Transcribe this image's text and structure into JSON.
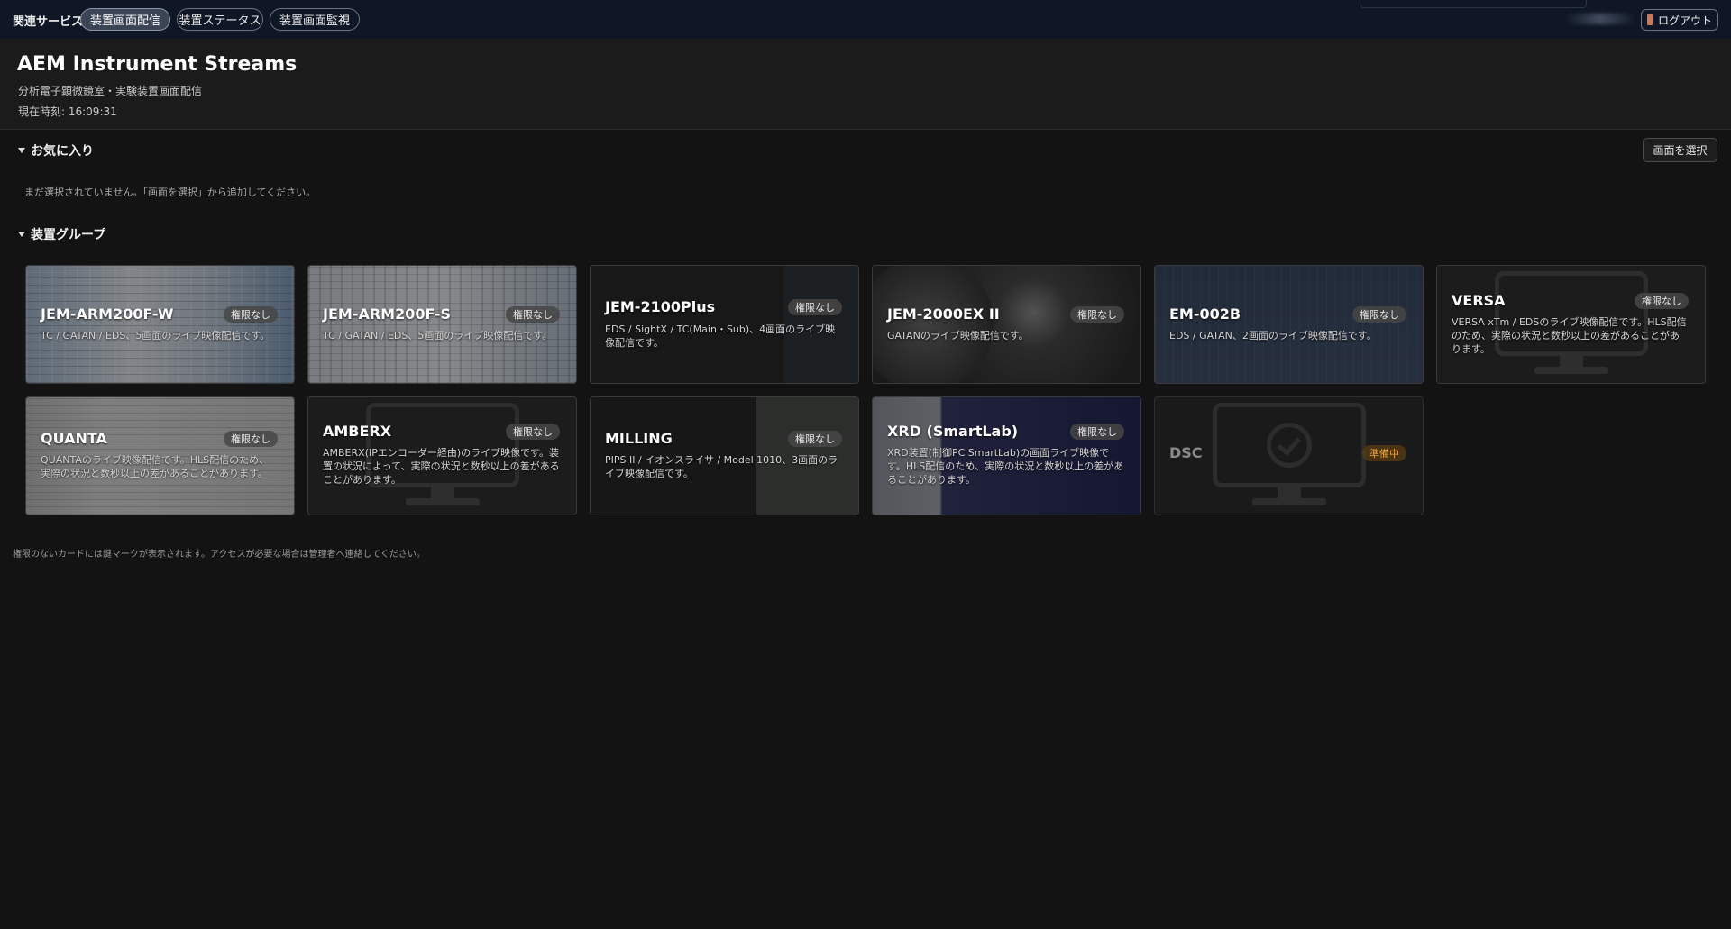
{
  "topbar": {
    "related_label": "関連サービス",
    "tabs": [
      {
        "label": "装置画面配信",
        "active": true
      },
      {
        "label": "装置ステータス",
        "active": false
      },
      {
        "label": "装置画面監視",
        "active": false
      }
    ],
    "logout_label": "ログアウト"
  },
  "header": {
    "title": "AEM Instrument Streams",
    "subtitle": "分析電子顕微鏡室・実験装置画面配信",
    "time": "現在時刻: 16:09:31"
  },
  "favorites": {
    "heading": "お気に入り",
    "select_button": "画面を選択",
    "empty_message": "まだ選択されていません。「画面を選択」から追加してください。"
  },
  "groups": {
    "heading": "装置グループ",
    "cards": [
      {
        "name": "JEM-ARM200F-W",
        "badge": "権限なし",
        "desc": "TC / GATAN / EDS、5画面のライブ映像配信です。"
      },
      {
        "name": "JEM-ARM200F-S",
        "badge": "権限なし",
        "desc": "TC / GATAN / EDS、5画面のライブ映像配信です。"
      },
      {
        "name": "JEM-2100Plus",
        "badge": "権限なし",
        "desc": "EDS / SightX / TC(Main・Sub)、4画面のライブ映像配信です。"
      },
      {
        "name": "JEM-2000EX II",
        "badge": "権限なし",
        "desc": "GATANのライブ映像配信です。"
      },
      {
        "name": "EM-002B",
        "badge": "権限なし",
        "desc": "EDS / GATAN、2画面のライブ映像配信です。"
      },
      {
        "name": "VERSA",
        "badge": "権限なし",
        "desc": "VERSA xTm / EDSのライブ映像配信です。HLS配信のため、実際の状況と数秒以上の差があることがあります。"
      },
      {
        "name": "QUANTA",
        "badge": "権限なし",
        "desc": "QUANTAのライブ映像配信です。HLS配信のため、実際の状況と数秒以上の差があることがあります。"
      },
      {
        "name": "AMBERX",
        "badge": "権限なし",
        "desc": "AMBERX(IPエンコーダー経由)のライブ映像です。装置の状況によって、実際の状況と数秒以上の差があることがあります。"
      },
      {
        "name": "MILLING",
        "badge": "権限なし",
        "desc": "PIPS II / イオンスライサ / Model 1010、3画面のライブ映像配信です。"
      },
      {
        "name": "XRD (SmartLab)",
        "badge": "権限なし",
        "desc": "XRD装置(制御PC SmartLab)の画面ライブ映像です。HLS配信のため、実際の状況と数秒以上の差があることがあります。"
      },
      {
        "name": "DSC",
        "badge": "準備中",
        "desc": ""
      }
    ]
  },
  "footnote": "権限のないカードには鍵マークが表示されます。アクセスが必要な場合は管理者へ連絡してください。"
}
